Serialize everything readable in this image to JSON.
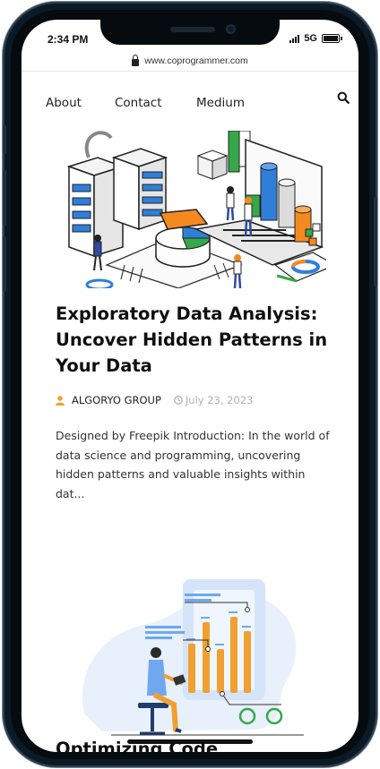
{
  "status": {
    "time": "2:34 PM",
    "network": "5G"
  },
  "browser": {
    "url": "www.coprogrammer.com"
  },
  "nav": {
    "about": "About",
    "contact": "Contact",
    "medium": "Medium"
  },
  "article": {
    "title": "Exploratory Data Analysis: Uncover Hidden Patterns in Your Data",
    "author": "ALGORYO GROUP",
    "date": "July 23, 2023",
    "excerpt": "Designed by  Freepik Introduction: In the world of data science and programming, uncovering hidden patterns and valuable insights within dat..."
  },
  "next_article": {
    "title_partial": "Optimizing Code"
  },
  "icons": {
    "lock": "lock-icon",
    "search": "search-icon",
    "user": "user-icon",
    "clock": "clock-icon",
    "signal": "signal-icon",
    "battery": "battery-icon"
  },
  "colors": {
    "accent_orange": "#f0a030",
    "chart_blue": "#2f7fd8",
    "chart_green": "#37a84a",
    "chart_orange": "#f48a1f",
    "frame": "#0b1a26"
  }
}
